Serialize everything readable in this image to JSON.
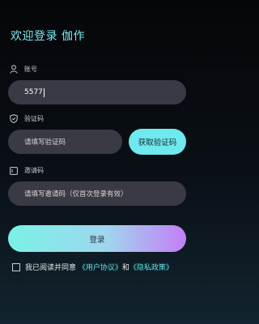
{
  "header": {
    "title": "欢迎登录 伽作"
  },
  "account": {
    "label": "账号",
    "value": "5577"
  },
  "verify": {
    "label": "验证码",
    "placeholder": "请填写验证码",
    "button": "获取验证码"
  },
  "invite": {
    "label": "邀请码",
    "placeholder": "请填写邀请码（仅首次登录有效）"
  },
  "login": {
    "button": "登录"
  },
  "agreement": {
    "prefix": "我已阅读并同意",
    "user_agreement": "《用户协议》",
    "and": "和",
    "privacy_policy": "《隐私政策》"
  },
  "colors": {
    "accent": "#6ee9ee",
    "field_bg": "#3a3a44"
  }
}
